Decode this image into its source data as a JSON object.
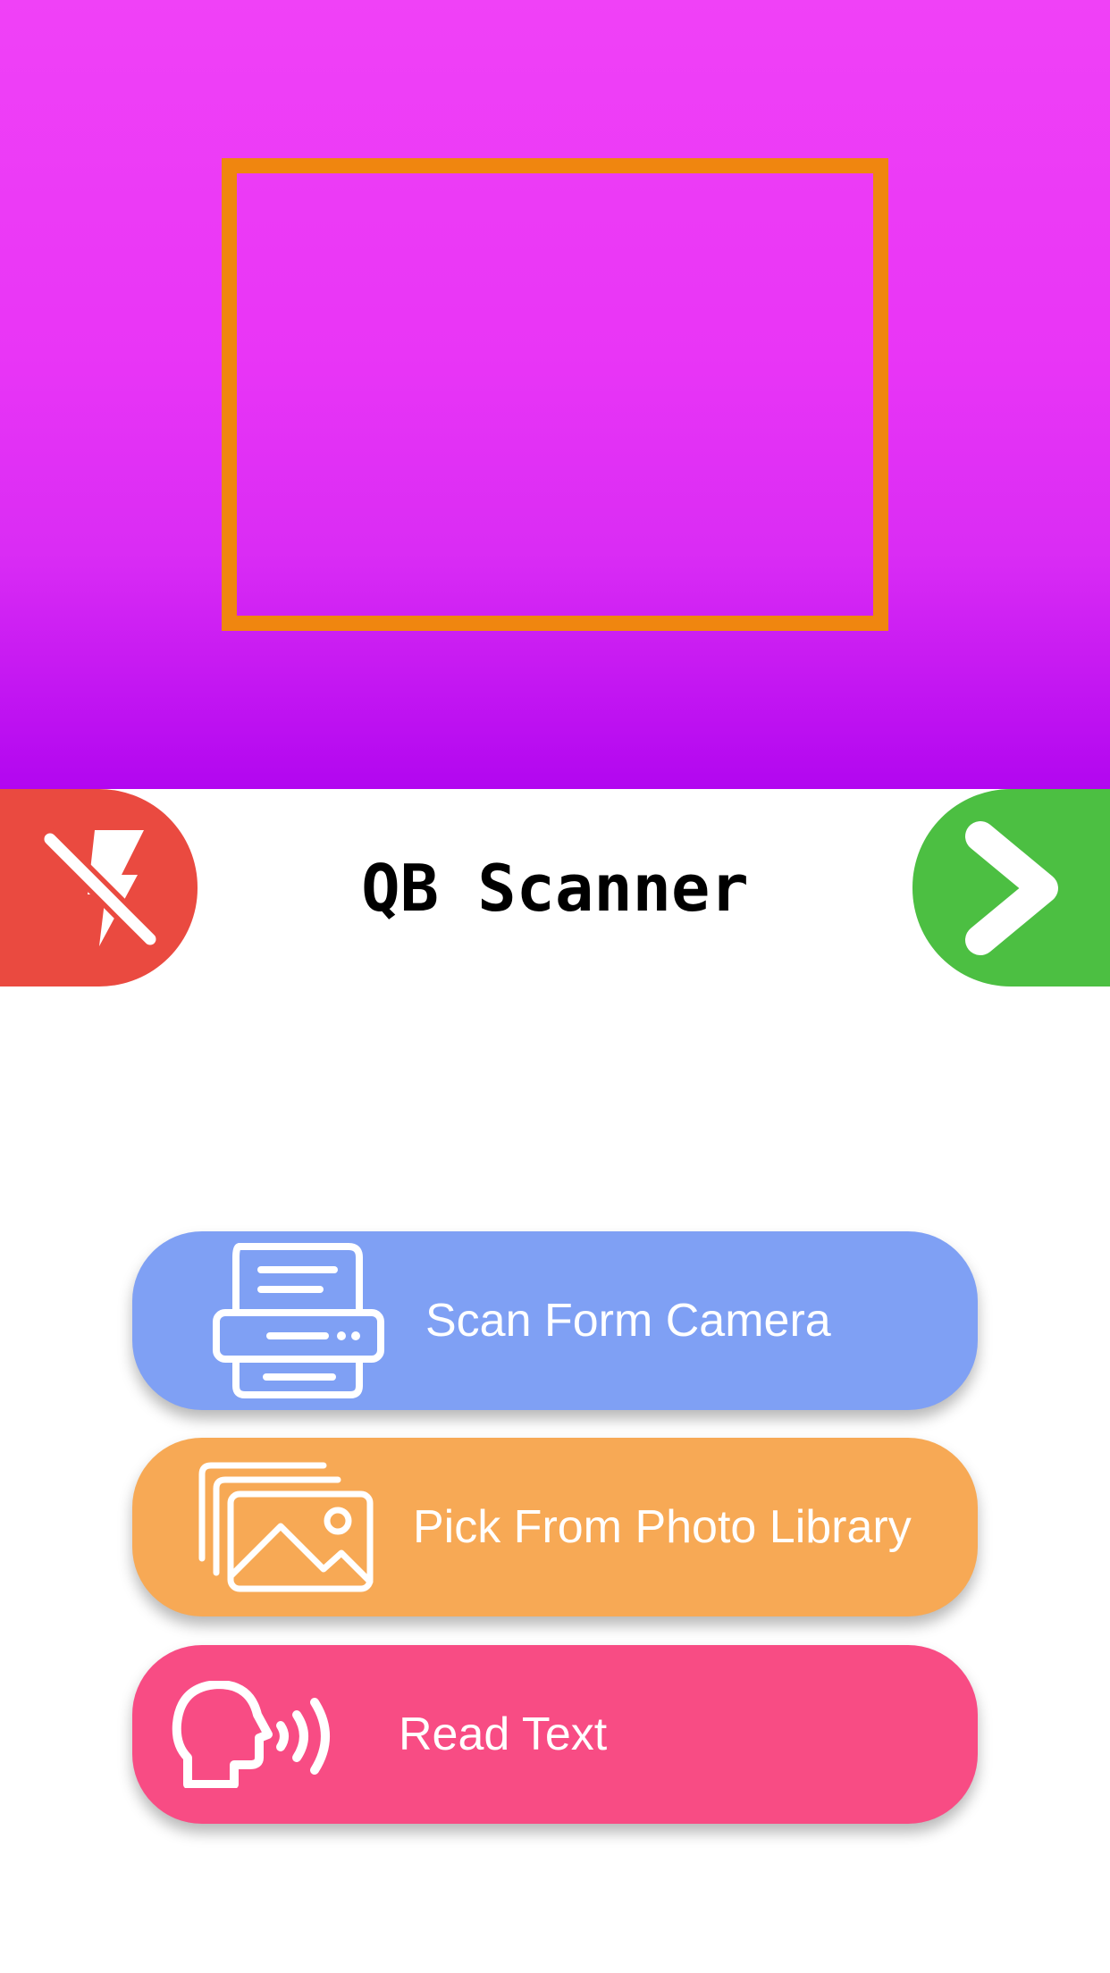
{
  "app": {
    "title": "QB Scanner"
  },
  "header": {
    "flash_icon": "flash-off-icon",
    "next_icon": "chevron-right-icon"
  },
  "actions": [
    {
      "label": "Scan Form Camera",
      "icon": "scanner-icon",
      "color": "#7fa0f4"
    },
    {
      "label": "Pick From Photo Library",
      "icon": "photo-library-icon",
      "color": "#f7a955"
    },
    {
      "label": "Read Text",
      "icon": "speaking-head-icon",
      "color": "#f84c84"
    }
  ],
  "colors": {
    "camera_gradient_top": "#f041f7",
    "camera_gradient_bottom": "#b206f0",
    "scan_frame": "#f0860f",
    "flash_button": "#ea4a40",
    "next_button": "#4cbf42"
  }
}
